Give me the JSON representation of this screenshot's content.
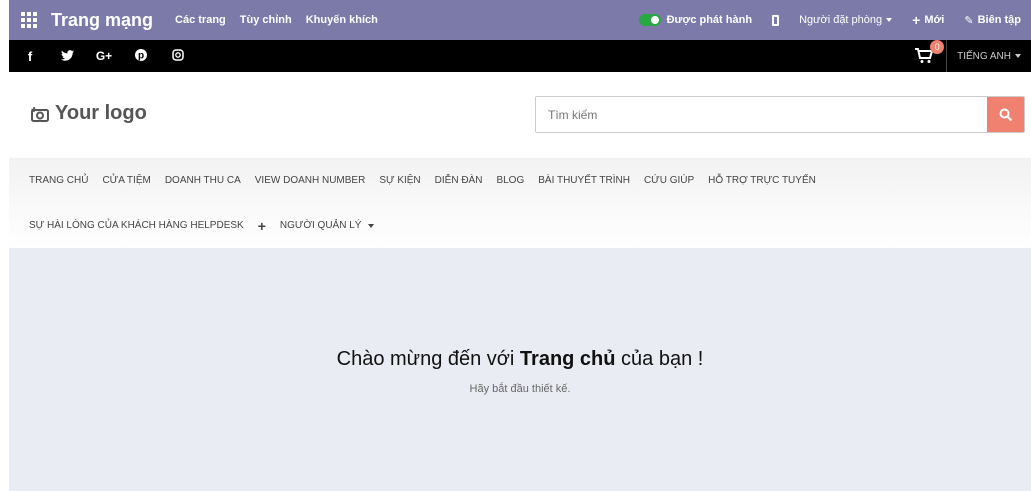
{
  "admin_bar": {
    "brand": "Trang mạng",
    "menu": [
      "Các trang",
      "Tùy chỉnh",
      "Khuyến khích"
    ],
    "published_label": "Được phát hành",
    "booking_label": "Người đặt phòng",
    "new_label": "Mới",
    "edit_label": "Biên tập"
  },
  "social": {
    "icons": [
      "f",
      "t",
      "G+",
      "p",
      "ig"
    ],
    "cart_count": "0",
    "language": "TIẾNG ANH"
  },
  "header": {
    "logo_text": "Your logo",
    "search_placeholder": "Tìm kiếm"
  },
  "nav": {
    "row1": [
      "TRANG CHỦ",
      "CỬA TIỆM",
      "DOANH THU CA",
      "VIEW DOANH NUMBER",
      "SỰ KIỆN",
      "DIỄN ĐÀN",
      "BLOG",
      "BÀI THUYẾT TRÌNH",
      "CỨU GIÚP",
      "HỖ TRỢ TRỰC TUYẾN"
    ],
    "row2_item": "SỰ HÀI LÒNG CỦA KHÁCH HÀNG HELPDESK",
    "plus": "+",
    "manager": "NGƯỜI QUẢN LÝ"
  },
  "main": {
    "welcome_prefix": "Chào mừng đến với ",
    "welcome_bold": "Trang chủ",
    "welcome_suffix": " của bạn !",
    "subtext": "Hãy bắt đầu thiết kế."
  },
  "colors": {
    "admin_bar": "#7b7aa8",
    "accent": "#f08070",
    "toggle_on": "#28a745"
  }
}
